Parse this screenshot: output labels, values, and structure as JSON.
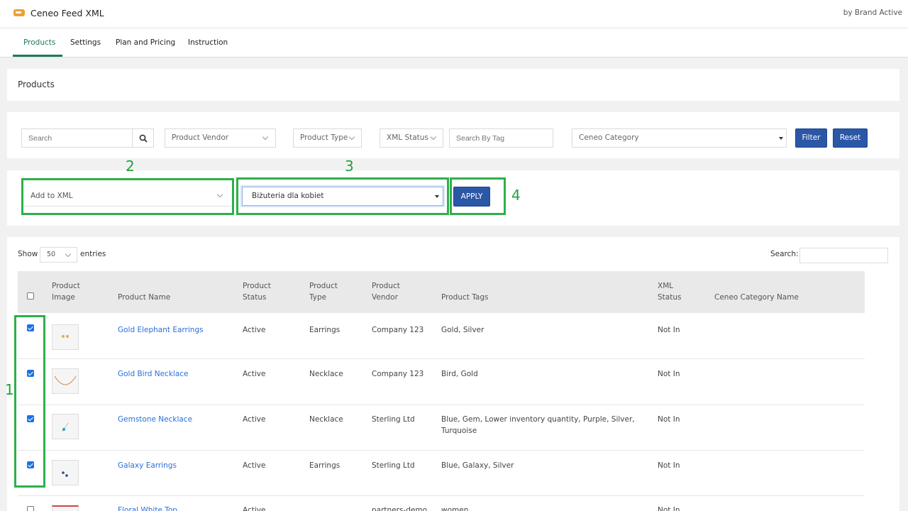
{
  "app": {
    "title": "Ceneo Feed XML",
    "by": "by Brand Active"
  },
  "nav": {
    "tabs": [
      "Products",
      "Settings",
      "Plan and Pricing",
      "Instruction"
    ]
  },
  "page": {
    "title": "Products"
  },
  "filters": {
    "search_placeholder": "Search",
    "vendor": "Product Vendor",
    "type": "Product Type",
    "xml_status": "XML Status",
    "tag_placeholder": "Search By Tag",
    "category": "Ceneo Category",
    "filter_label": "Filter",
    "reset_label": "Reset"
  },
  "bulk": {
    "action": "Add to XML",
    "category": "Biżuteria dla kobiet",
    "apply_label": "APPLY"
  },
  "annotations": [
    "1",
    "2",
    "3",
    "4"
  ],
  "table": {
    "show_label": "Show",
    "entries_value": "50",
    "entries_label": "entries",
    "search_label": "Search:",
    "headers": {
      "image": [
        "Product",
        "Image"
      ],
      "name": "Product Name",
      "status": [
        "Product",
        "Status"
      ],
      "type": [
        "Product",
        "Type"
      ],
      "vendor": [
        "Product",
        "Vendor"
      ],
      "tags": "Product Tags",
      "xml": [
        "XML",
        "Status"
      ],
      "ceneo": "Ceneo Category Name"
    },
    "rows": [
      {
        "name": "Gold Elephant Earrings",
        "status": "Active",
        "type": "Earrings",
        "vendor": "Company 123",
        "tags": "Gold, Silver",
        "xml": "Not In",
        "ceneo": ""
      },
      {
        "name": "Gold Bird Necklace",
        "status": "Active",
        "type": "Necklace",
        "vendor": "Company 123",
        "tags": "Bird, Gold",
        "xml": "Not In",
        "ceneo": ""
      },
      {
        "name": "Gemstone Necklace",
        "status": "Active",
        "type": "Necklace",
        "vendor": "Sterling Ltd",
        "tags": "Blue, Gem, Lower inventory quantity, Purple, Silver,",
        "tags2": "Turquoise",
        "xml": "Not In",
        "ceneo": ""
      },
      {
        "name": "Galaxy Earrings",
        "status": "Active",
        "type": "Earrings",
        "vendor": "Sterling Ltd",
        "tags": "Blue, Galaxy, Silver",
        "xml": "Not In",
        "ceneo": ""
      },
      {
        "name": "Floral White Top",
        "status": "Active",
        "type": "",
        "vendor": "partners-demo",
        "tags": "women",
        "xml": "Not In",
        "ceneo": ""
      }
    ]
  },
  "colors": {
    "accent_green": "#1f7a55",
    "button_blue": "#2b57a7",
    "link_blue": "#2a6fdb",
    "annotation_green": "#2eb04a"
  }
}
